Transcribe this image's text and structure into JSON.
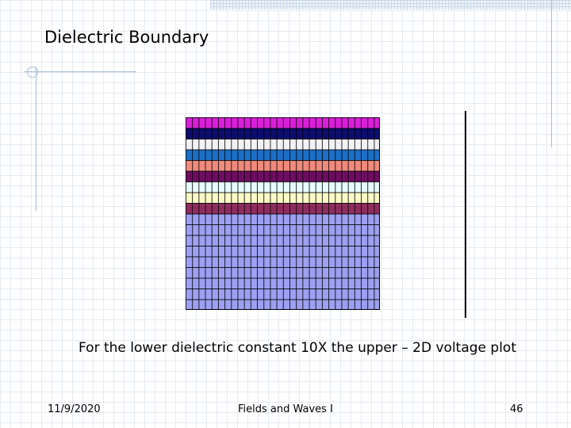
{
  "slide": {
    "title": "Dielectric Boundary",
    "caption": "For the lower dielectric constant 10X the upper – 2D voltage plot"
  },
  "footer": {
    "date": "11/9/2020",
    "course": "Fields and Waves I",
    "page_number": "46"
  },
  "plot": {
    "band_colors": [
      "#d91fd9",
      "#0d0d6e",
      "#f2f2f5",
      "#1c6fc7",
      "#f08a7c",
      "#6e0d62",
      "#e8fbfb",
      "#fafac6",
      "#8e2d5e"
    ],
    "lower_region_color": "#9da0f2"
  }
}
